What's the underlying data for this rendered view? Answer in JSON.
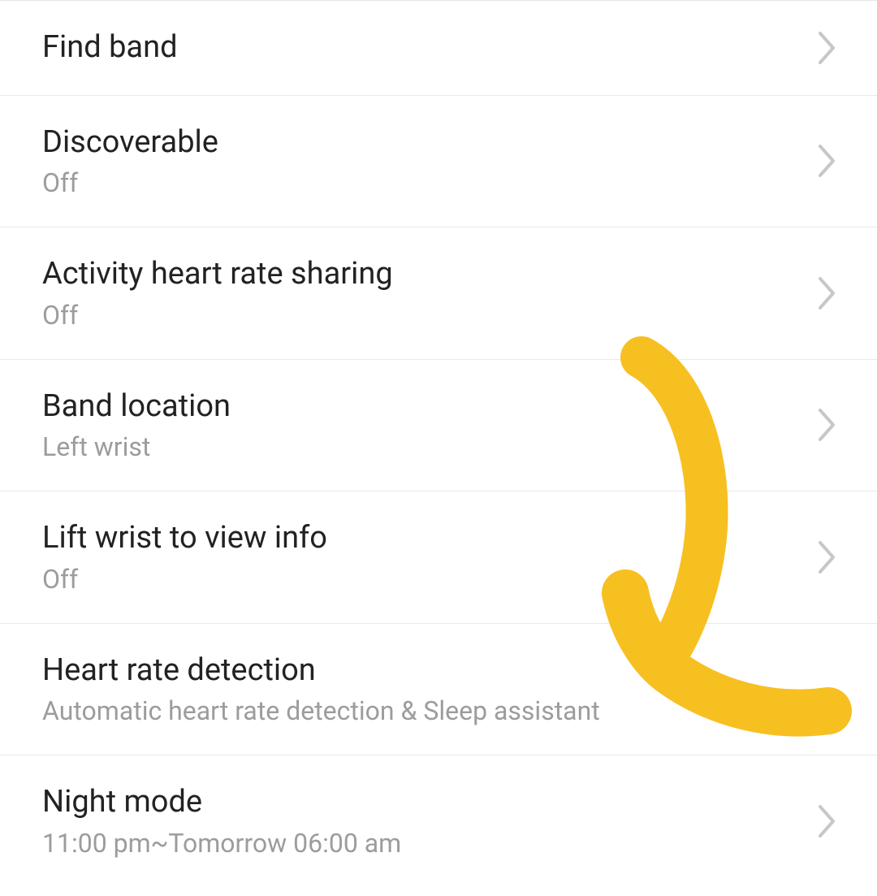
{
  "settings": {
    "items": [
      {
        "title": "Find band",
        "subtitle": null,
        "chevron": true
      },
      {
        "title": "Discoverable",
        "subtitle": "Off",
        "chevron": true
      },
      {
        "title": "Activity heart rate sharing",
        "subtitle": "Off",
        "chevron": true
      },
      {
        "title": "Band location",
        "subtitle": "Left wrist",
        "chevron": true
      },
      {
        "title": "Lift wrist to view info",
        "subtitle": "Off",
        "chevron": true
      },
      {
        "title": "Heart rate detection",
        "subtitle": "Automatic heart rate detection & Sleep assistant",
        "chevron": false
      },
      {
        "title": "Night mode",
        "subtitle": "11:00 pm~Tomorrow 06:00 am",
        "chevron": true
      }
    ]
  },
  "annotation": {
    "type": "hand-drawn-arrow",
    "color": "#f7c021",
    "points_to_item_index": 5
  }
}
